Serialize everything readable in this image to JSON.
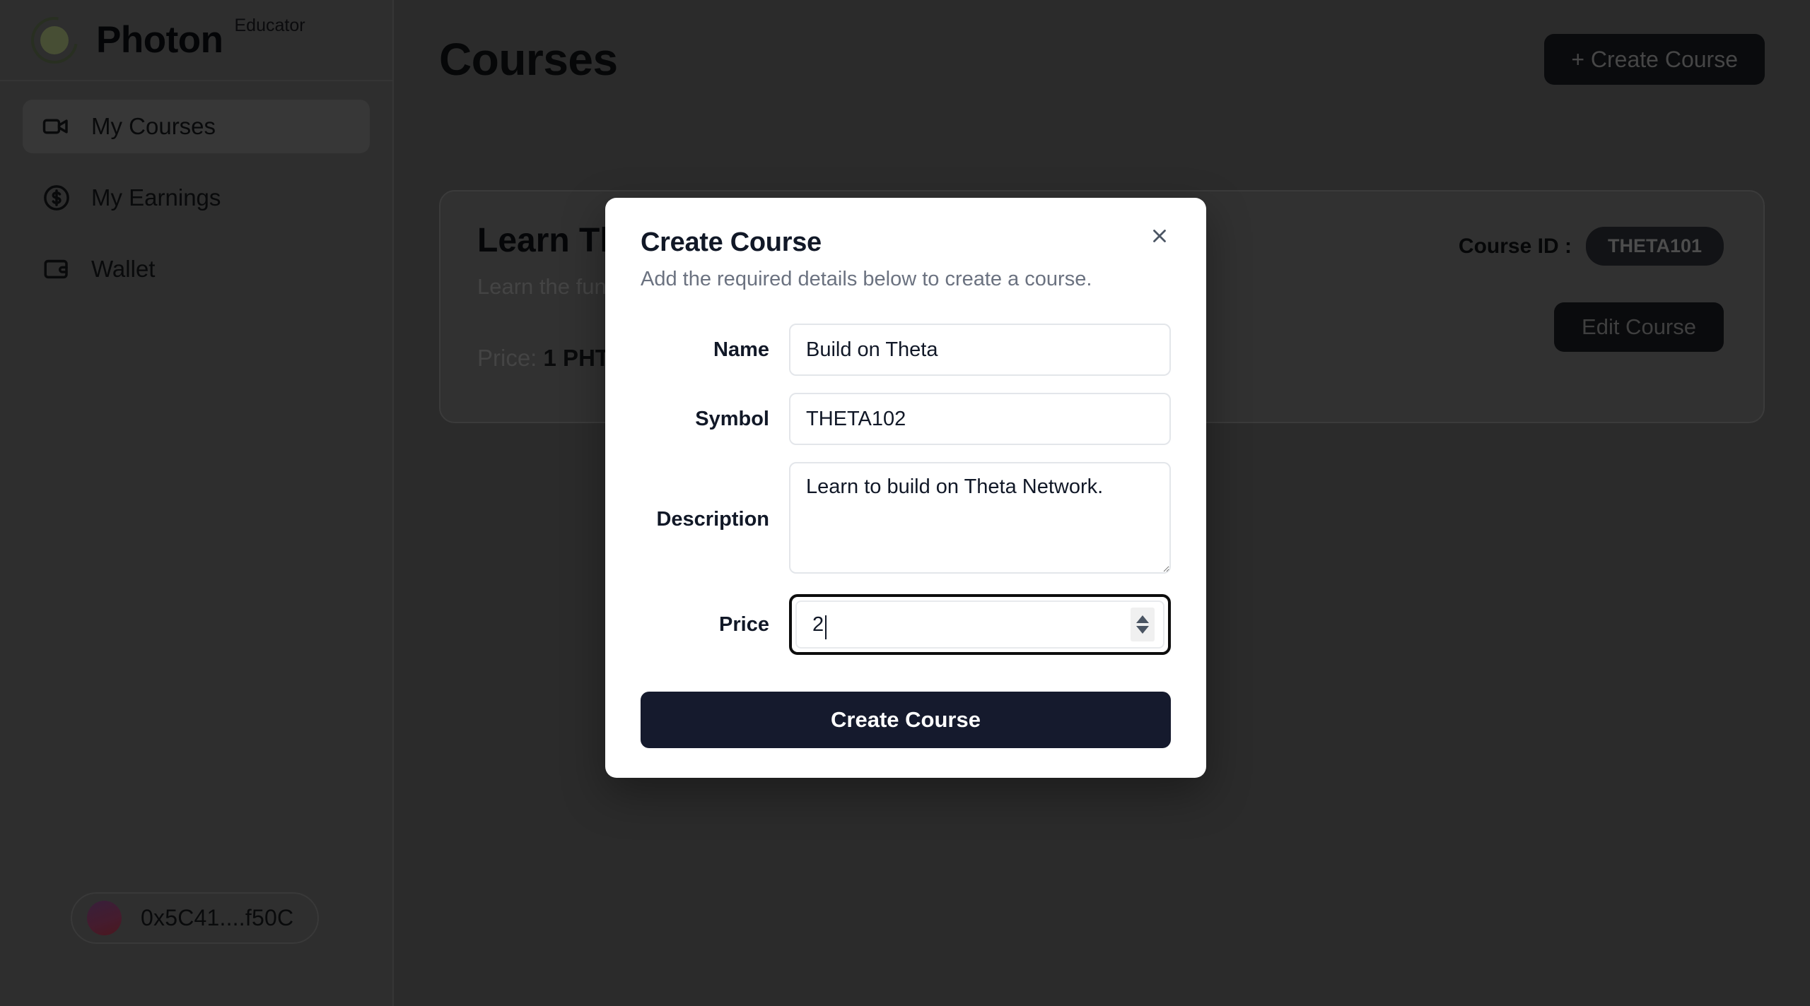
{
  "brand": {
    "name": "Photon",
    "role": "Educator",
    "logo_icon": "photon-ring-logo"
  },
  "sidebar": {
    "items": [
      {
        "label": "My Courses",
        "icon": "video-camera-icon",
        "active": true
      },
      {
        "label": "My Earnings",
        "icon": "dollar-circle-icon",
        "active": false
      },
      {
        "label": "Wallet",
        "icon": "wallet-icon",
        "active": false
      }
    ],
    "wallet_chip": {
      "address": "0x5C41....f50C",
      "avatar_colors": [
        "#3d2240",
        "#4a1f33",
        "#521a22"
      ]
    }
  },
  "header": {
    "title": "Courses",
    "create_button": "+ Create Course"
  },
  "course_card": {
    "title": "Learn Theta Basics",
    "description": "Learn the fundamentals of Theta Network.",
    "price_label": "Price:",
    "price_value": "1 PHT",
    "course_id_label": "Course ID :",
    "course_id_value": "THETA101",
    "edit_button": "Edit Course"
  },
  "modal": {
    "title": "Create Course",
    "subtitle": "Add the required details below to create a course.",
    "close_icon": "close-icon",
    "fields": {
      "name": {
        "label": "Name",
        "value": "Build on Theta",
        "placeholder": ""
      },
      "symbol": {
        "label": "Symbol",
        "value": "THETA102",
        "placeholder": ""
      },
      "description": {
        "label": "Description",
        "value": "Learn to build on Theta Network.",
        "placeholder": ""
      },
      "price": {
        "label": "Price",
        "value": "2",
        "placeholder": "",
        "focused": true
      }
    },
    "submit_button": "Create Course"
  },
  "colors": {
    "sidebar_bg": "#323232",
    "main_bg": "#2f2f2f",
    "card_bg": "#363636",
    "dark_button": "#0b0c0f",
    "modal_bg": "#ffffff",
    "submit_navy": "#151a2d",
    "muted_text": "#6b7280"
  }
}
